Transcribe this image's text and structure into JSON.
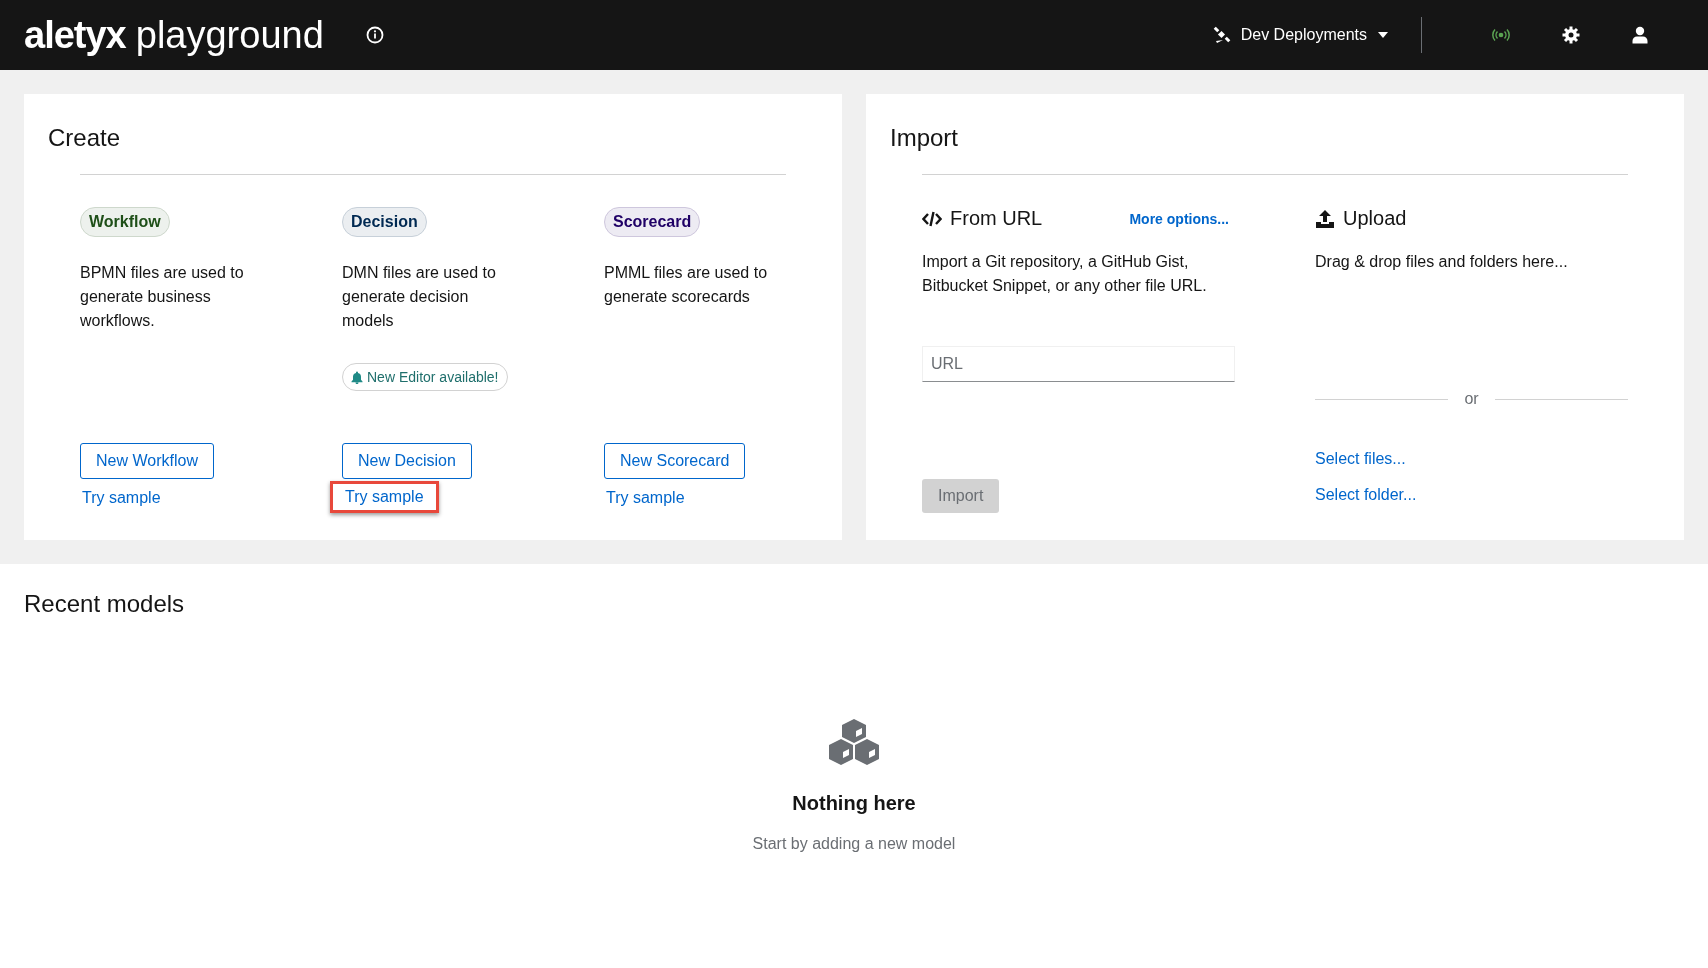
{
  "header": {
    "brand": "aletyx",
    "product": "playground",
    "deployments": "Dev Deployments"
  },
  "create": {
    "title": "Create",
    "items": [
      {
        "tag": "Workflow",
        "color": "#1e4f18",
        "description": "BPMN files are used to generate business workflows.",
        "button": "New Workflow",
        "sample": "Try sample",
        "highlighted": false
      },
      {
        "tag": "Decision",
        "color": "#002952",
        "description": "DMN files are used to generate decision models",
        "notice": "New Editor available!",
        "button": "New Decision",
        "sample": "Try sample",
        "highlighted": true
      },
      {
        "tag": "Scorecard",
        "color": "#1f0066",
        "description": "PMML files are used to generate scorecards",
        "button": "New Scorecard",
        "sample": "Try sample",
        "highlighted": false
      }
    ]
  },
  "import": {
    "title": "Import",
    "from_url": {
      "title": "From URL",
      "more": "More options...",
      "description": "Import a Git repository, a GitHub Gist, Bitbucket Snippet, or any other file URL.",
      "placeholder": "URL",
      "button": "Import",
      "disabled": true
    },
    "upload": {
      "title": "Upload",
      "description": "Drag & drop files and folders here...",
      "or": "or",
      "select_files": "Select files...",
      "select_folder": "Select folder..."
    }
  },
  "recent": {
    "title": "Recent models",
    "empty_title": "Nothing here",
    "empty_text": "Start by adding a new model"
  }
}
